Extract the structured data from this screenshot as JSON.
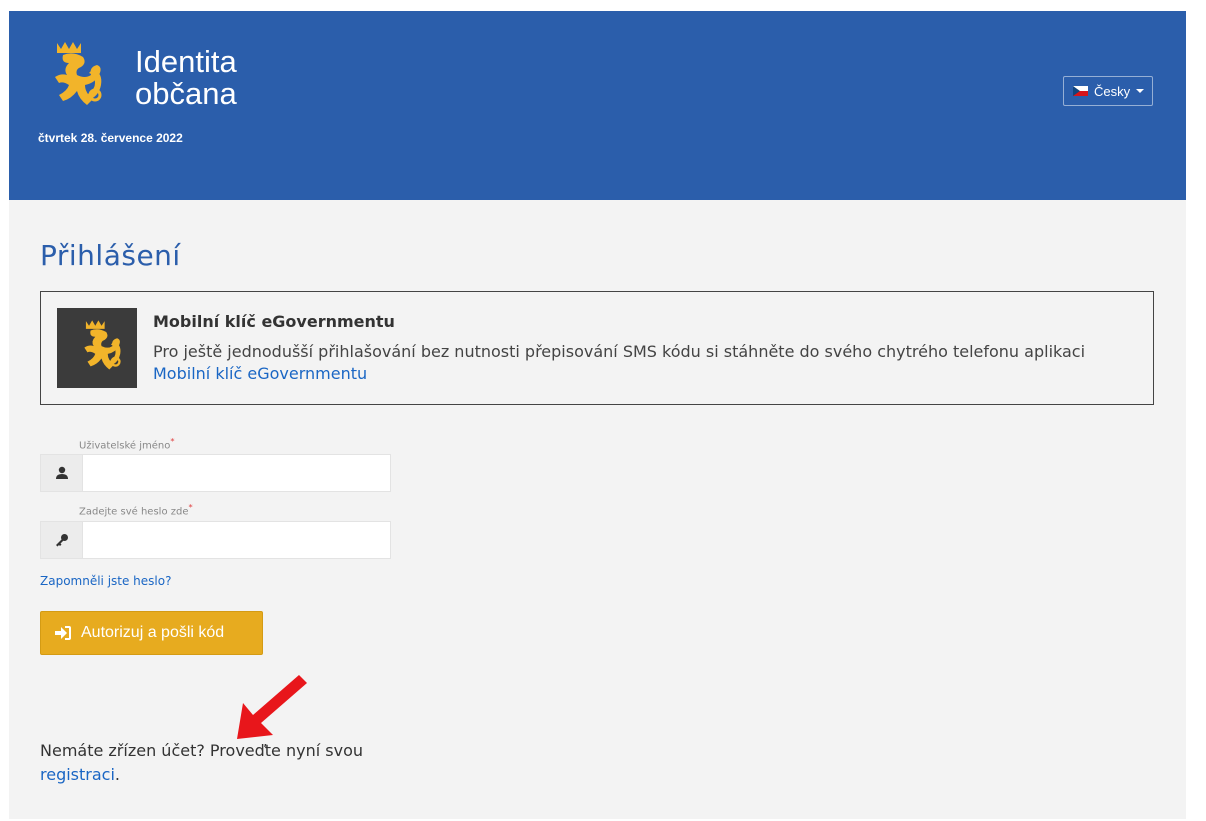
{
  "header": {
    "brand_line1": "Identita",
    "brand_line2": "občana",
    "date": "čtvrtek 28. července 2022",
    "language": "Česky"
  },
  "page": {
    "title": "Přihlášení"
  },
  "promo": {
    "heading": "Mobilní klíč eGovernmentu",
    "body_prefix": "Pro ještě jednodušší přihlašování bez nutnosti přepisování SMS kódu si stáhněte do svého chytrého telefonu aplikaci ",
    "link_text": "Mobilní klíč eGovernmentu"
  },
  "form": {
    "username_label": "Uživatelské jméno",
    "password_label": "Zadejte své heslo zde",
    "required_mark": "*",
    "username_value": "",
    "password_value": "",
    "forgot_link": "Zapomněli jste heslo?",
    "submit_label": "Autorizuj a pošli kód"
  },
  "register": {
    "prefix": "Nemáte zřízen účet? Proveďte nyní svou ",
    "link_text": "registraci",
    "suffix": "."
  },
  "colors": {
    "header_bg": "#2b5eab",
    "accent_button": "#e7ab1f",
    "link": "#1a66c4",
    "annotation_arrow": "#e8161b"
  },
  "icons": {
    "logo": "czech-lion-emblem",
    "language_flag": "czech-flag-icon",
    "username": "user-icon",
    "password": "key-icon",
    "submit": "sign-in-icon",
    "annotation": "red-arrow-icon"
  }
}
